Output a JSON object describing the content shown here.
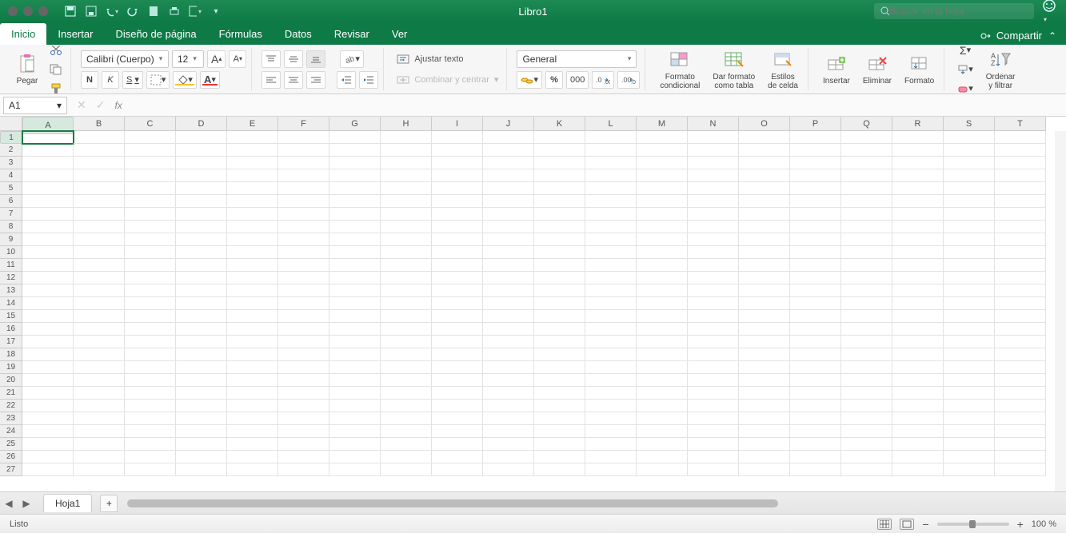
{
  "window": {
    "title": "Libro1"
  },
  "search": {
    "placeholder": "Buscar en la hoja"
  },
  "tabs": [
    "Inicio",
    "Insertar",
    "Diseño de página",
    "Fórmulas",
    "Datos",
    "Revisar",
    "Ver"
  ],
  "active_tab": 0,
  "share_label": "Compartir",
  "ribbon": {
    "paste_label": "Pegar",
    "font_name": "Calibri (Cuerpo)",
    "font_size": "12",
    "bold": "N",
    "italic": "K",
    "underline": "S",
    "font_a_big": "A",
    "font_a_small": "A",
    "wrap_text": "Ajustar texto",
    "merge_center": "Combinar y centrar",
    "number_format": "General",
    "thousands": "000",
    "conditional_fmt": "Formato\ncondicional",
    "format_table": "Dar formato\ncomo tabla",
    "cell_styles": "Estilos\nde celda",
    "insert": "Insertar",
    "delete": "Eliminar",
    "format": "Formato",
    "sort_filter": "Ordenar\ny filtrar"
  },
  "namebox": "A1",
  "fx": "fx",
  "columns": [
    "A",
    "B",
    "C",
    "D",
    "E",
    "F",
    "G",
    "H",
    "I",
    "J",
    "K",
    "L",
    "M",
    "N",
    "O",
    "P",
    "Q",
    "R",
    "S",
    "T"
  ],
  "rows": [
    "1",
    "2",
    "3",
    "4",
    "5",
    "6",
    "7",
    "8",
    "9",
    "10",
    "11",
    "12",
    "13",
    "14",
    "15",
    "16",
    "17",
    "18",
    "19",
    "20",
    "21",
    "22",
    "23",
    "24",
    "25",
    "26",
    "27"
  ],
  "sheet_tab": "Hoja1",
  "status": "Listo",
  "zoom": "100 %"
}
